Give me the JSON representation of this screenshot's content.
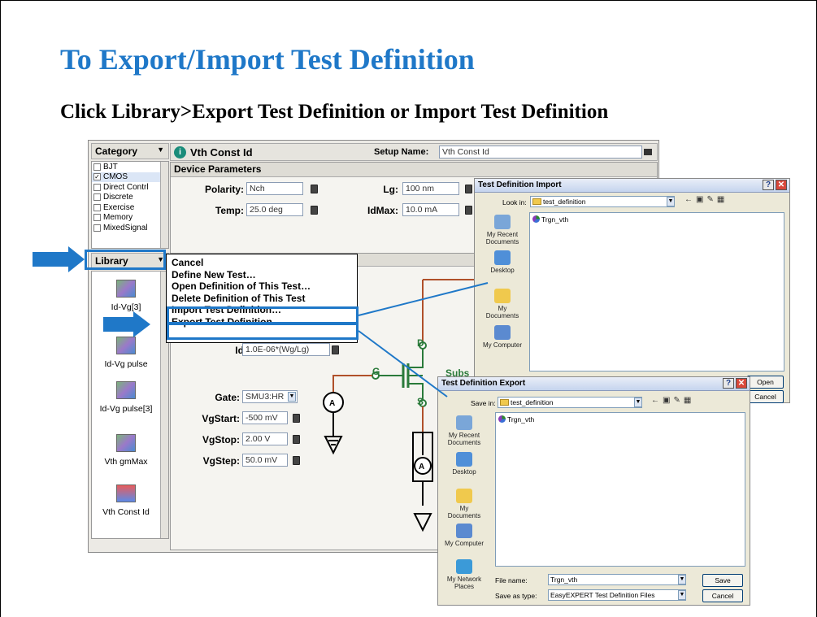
{
  "slide": {
    "title": "To Export/Import Test Definition",
    "subtitle": "Click Library>Export Test Definition or Import Test Definition",
    "accent_color": "#1f78c8"
  },
  "app": {
    "category_label": "Category",
    "categories": [
      {
        "label": "BJT",
        "checked": false
      },
      {
        "label": "CMOS",
        "checked": true
      },
      {
        "label": "Direct Contrl",
        "checked": false
      },
      {
        "label": "Discrete",
        "checked": false
      },
      {
        "label": "Exercise",
        "checked": false
      },
      {
        "label": "Memory",
        "checked": false
      },
      {
        "label": "MixedSignal",
        "checked": false
      }
    ],
    "library_label": "Library",
    "tools": [
      "Id-Vg[3]",
      "Id-Vg pulse",
      "Id-Vg pulse[3]",
      "Vth gmMax",
      "Vth Const Id"
    ],
    "test_title": "Vth Const Id",
    "setup_name_label": "Setup Name:",
    "setup_name_value": "Vth Const Id",
    "device_params_label": "Device Parameters",
    "params": {
      "polarity_label": "Polarity:",
      "polarity_value": "Nch",
      "temp_label": "Temp:",
      "temp_value": "25.0 deg",
      "lg_label": "Lg:",
      "lg_value": "100 nm",
      "idmax_label": "IdMax:",
      "idmax_value": "10.0 mA",
      "idvth_label": "Id@Vth:",
      "idvth_value": "1.0E-06*(Wg/Lg)",
      "gate_label": "Gate:",
      "gate_value": "SMU3:HR",
      "vgstart_label": "VgStart:",
      "vgstart_value": "-500 mV",
      "vgstop_label": "VgStop:",
      "vgstop_value": "2.00 V",
      "vgstep_label": "VgStep:",
      "vgstep_value": "50.0 mV"
    },
    "schematic": {
      "d": "D",
      "g": "G",
      "s": "S",
      "subs": "Subs"
    }
  },
  "menu": {
    "items": [
      "Cancel",
      "Define New Test…",
      "Open Definition of This Test…",
      "Delete Definition of This Test",
      "Import Test Definition…",
      "Export Test Definition…"
    ],
    "highlight_color": "#1f78c8"
  },
  "import_dialog": {
    "title": "Test Definition Import",
    "look_in_label": "Look in:",
    "folder": "test_definition",
    "places": [
      "My Recent Documents",
      "Desktop",
      "My Documents",
      "My Computer"
    ],
    "files": [
      "Trgn_vth"
    ],
    "open_button": "Open",
    "cancel_button": "Cancel"
  },
  "export_dialog": {
    "title": "Test Definition Export",
    "save_in_label": "Save in:",
    "folder": "test_definition",
    "places": [
      "My Recent Documents",
      "Desktop",
      "My Documents",
      "My Computer",
      "My Network Places"
    ],
    "files": [
      "Trgn_vth"
    ],
    "file_name_label": "File name:",
    "file_name_value": "Trgn_vth",
    "save_type_label": "Save as type:",
    "save_type_value": "EasyEXPERT Test Definition Files",
    "save_button": "Save",
    "cancel_button": "Cancel"
  }
}
